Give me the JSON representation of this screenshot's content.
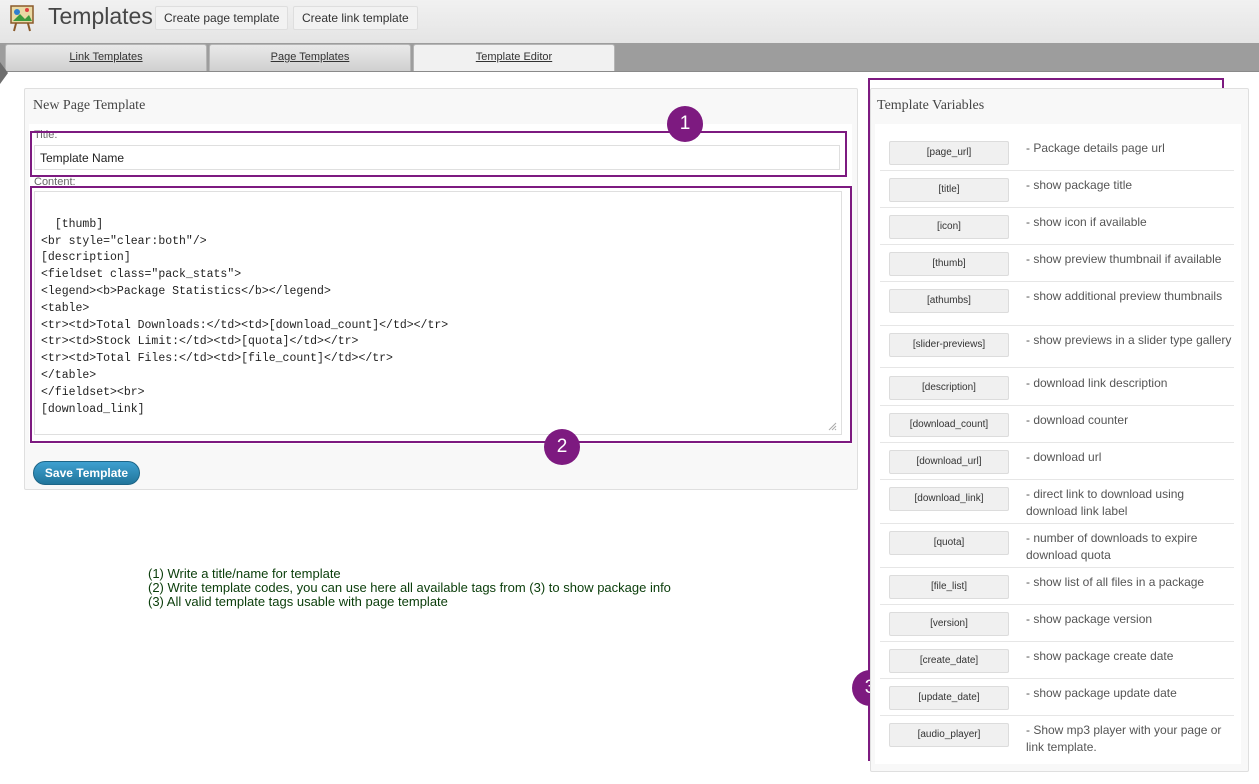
{
  "header": {
    "title": "Templates",
    "buttons": [
      "Create page template",
      "Create link template"
    ]
  },
  "tabs": [
    {
      "label": "Link Templates",
      "active": false
    },
    {
      "label": "Page Templates",
      "active": false
    },
    {
      "label": "Template Editor",
      "active": true
    }
  ],
  "editor": {
    "panel_title": "New Page Template",
    "title_label": "Title:",
    "title_value": "Template Name",
    "content_label": "Content:",
    "content_value": "[thumb]\n<br style=\"clear:both\"/>\n[description]\n<fieldset class=\"pack_stats\">\n<legend><b>Package Statistics</b></legend>\n<table>\n<tr><td>Total Downloads:</td><td>[download_count]</td></tr>\n<tr><td>Stock Limit:</td><td>[quota]</td></tr>\n<tr><td>Total Files:</td><td>[file_count]</td></tr>\n</table>\n</fieldset><br>\n[download_link]",
    "save_label": "Save Template"
  },
  "markers": [
    "1",
    "2",
    "3"
  ],
  "notes": [
    "(1) Write a title/name for template",
    "(2) Write template codes, you can use here all available tags from (3) to show package info",
    "(3) All valid template tags usable with page template"
  ],
  "variables": {
    "panel_title": "Template Variables",
    "items": [
      {
        "tag": "[page_url]",
        "desc": "- Package details page url"
      },
      {
        "tag": "[title]",
        "desc": "- show package title"
      },
      {
        "tag": "[icon]",
        "desc": "- show icon if available"
      },
      {
        "tag": "[thumb]",
        "desc": "- show preview thumbnail if available"
      },
      {
        "tag": "[athumbs]",
        "desc": "- show additional preview thumbnails"
      },
      {
        "tag": "[slider-previews]",
        "desc": "- show previews in a slider type gallery"
      },
      {
        "tag": "[description]",
        "desc": "- download link description"
      },
      {
        "tag": "[download_count]",
        "desc": "- download counter"
      },
      {
        "tag": "[download_url]",
        "desc": "- download url"
      },
      {
        "tag": "[download_link]",
        "desc": "- direct link to download using download link label"
      },
      {
        "tag": "[quota]",
        "desc": "- number of downloads to expire download quota"
      },
      {
        "tag": "[file_list]",
        "desc": "- show list of all files in a package"
      },
      {
        "tag": "[version]",
        "desc": "- show package version"
      },
      {
        "tag": "[create_date]",
        "desc": "- show package create date"
      },
      {
        "tag": "[update_date]",
        "desc": "- show package update date"
      },
      {
        "tag": "[audio_player]",
        "desc": "- Show mp3 player with your page or link template."
      }
    ]
  },
  "colors": {
    "accent": "#21759b",
    "highlight": "#7d1a80",
    "notes_text": "#0a3d0a"
  }
}
